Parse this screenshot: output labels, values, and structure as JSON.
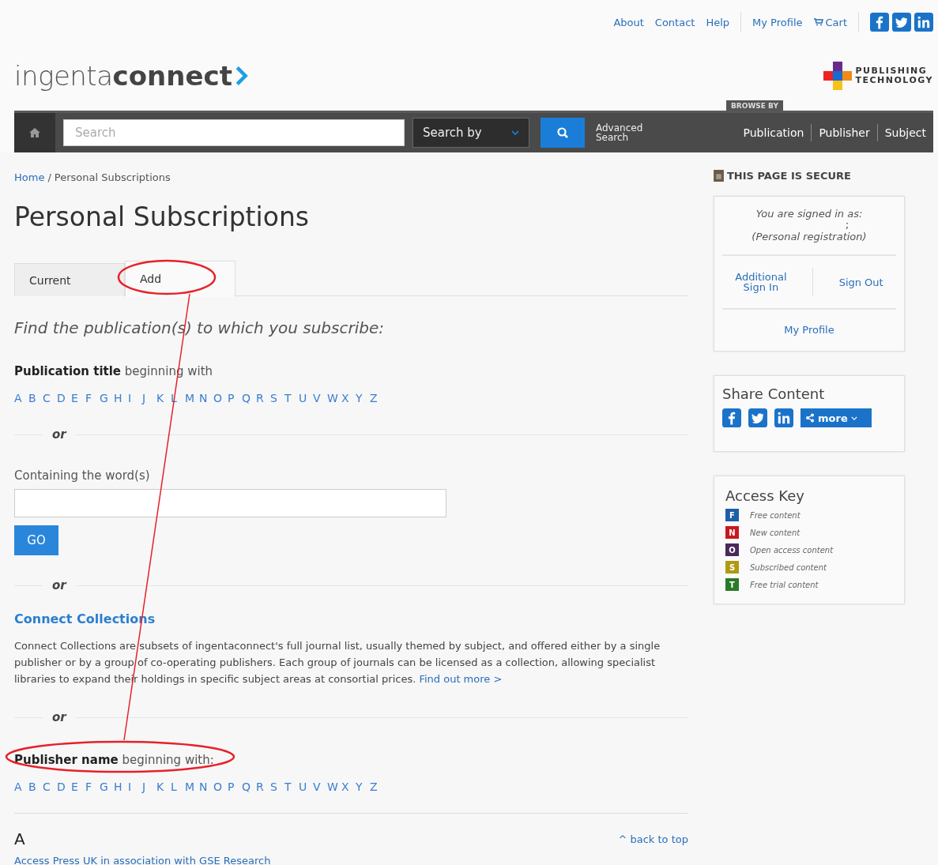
{
  "top_links": [
    {
      "label": "About",
      "kind": "link"
    },
    {
      "label": "Contact",
      "kind": "link"
    },
    {
      "label": "Help",
      "kind": "link"
    },
    {
      "label": "My Profile",
      "kind": "link"
    },
    {
      "label": "Cart",
      "kind": "cart"
    }
  ],
  "logo": {
    "light": "ingenta",
    "bold": "connect"
  },
  "partner_logo": {
    "line1": "PUBLISHING",
    "line2": "TECHNOLOGY"
  },
  "nav": {
    "search_placeholder": "Search",
    "search_by": "Search by",
    "advanced": [
      "Advanced",
      "Search"
    ],
    "browse_label": "BROWSE BY",
    "browse_links": [
      "Publication",
      "Publisher",
      "Subject"
    ]
  },
  "breadcrumb": {
    "home": "Home",
    "separator": "/",
    "current": "Personal Subscriptions"
  },
  "title": "Personal Subscriptions",
  "tabs": [
    {
      "label": "Current",
      "selected": false
    },
    {
      "label": "Add",
      "selected": true
    }
  ],
  "intro": "Find the publication(s) to which you subscribe:",
  "title_browse": {
    "label": "**Publication title** beginning with",
    "letters": [
      "A",
      "B",
      "C",
      "D",
      "E",
      "F",
      "G",
      "H",
      "I",
      "J",
      "K",
      "L",
      "M",
      "N",
      "O",
      "P",
      "Q",
      "R",
      "S",
      "T",
      "U",
      "V",
      "W",
      "X",
      "Y",
      "Z"
    ]
  },
  "or_1": "or",
  "words": {
    "label": "Containing the word(s)",
    "button": "GO"
  },
  "or_2": "or",
  "collections": {
    "heading": "Connect Collections",
    "text": "Connect Collections are subsets of ingentaconnect's full journal list, usually themed by subject, and offered either by a single publisher or by a group of co-operating publishers. Each group of journals can be licensed as a collection, allowing specialist libraries to expand their holdings in specific subject areas at consortial prices.",
    "link": "Find out more >"
  },
  "or_3": "or",
  "publisher_browse": {
    "label": "**Publisher name** beginning with:",
    "letters": [
      "A",
      "B",
      "C",
      "D",
      "E",
      "F",
      "G",
      "H",
      "I",
      "J",
      "K",
      "L",
      "M",
      "N",
      "O",
      "P",
      "Q",
      "R",
      "S",
      "T",
      "U",
      "V",
      "W",
      "X",
      "Y",
      "Z"
    ]
  },
  "listing": {
    "letter": "A",
    "back_to_top": "^ back to top",
    "first_item": "Access Press UK in association with GSE Research"
  },
  "sidebar": {
    "secure": "THIS PAGE IS SECURE",
    "signed_in": "You are signed in as:",
    "name": ";",
    "registration": "(Personal registration)",
    "additional": [
      "Additional",
      "Sign In"
    ],
    "sign_out": "Sign Out",
    "my_profile": "My Profile",
    "share_title": "Share Content",
    "share_more": "more",
    "key_title": "Access Key",
    "key": [
      {
        "letter": "F",
        "label": "Free content",
        "color": "#1f5fa8"
      },
      {
        "letter": "N",
        "label": "New content",
        "color": "#c8191e"
      },
      {
        "letter": "O",
        "label": "Open access content",
        "color": "#4a2a5a"
      },
      {
        "letter": "S",
        "label": "Subscribed content",
        "color": "#b09a12"
      },
      {
        "letter": "T",
        "label": "Free trial content",
        "color": "#2a7a2a"
      }
    ]
  }
}
